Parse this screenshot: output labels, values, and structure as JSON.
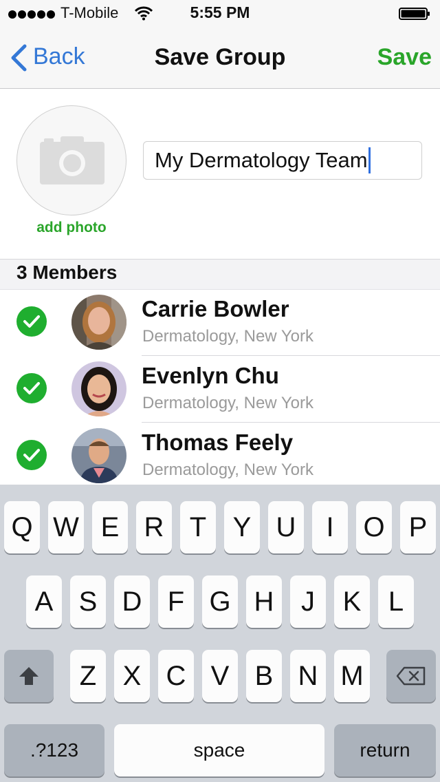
{
  "status_bar": {
    "carrier": "T-Mobile",
    "time": "5:55 PM"
  },
  "nav": {
    "back_label": "Back",
    "title": "Save Group",
    "save_label": "Save"
  },
  "group": {
    "add_photo_label": "add photo",
    "name_value": "My Dermatology Team"
  },
  "members": {
    "header": "3 Members",
    "items": [
      {
        "name": "Carrie Bowler",
        "subtitle": "Dermatology, New York",
        "selected": true
      },
      {
        "name": "Evenlyn Chu",
        "subtitle": "Dermatology, New York",
        "selected": true
      },
      {
        "name": "Thomas Feely",
        "subtitle": "Dermatology, New York",
        "selected": true
      }
    ]
  },
  "keyboard": {
    "row1": [
      "Q",
      "W",
      "E",
      "R",
      "T",
      "Y",
      "U",
      "I",
      "O",
      "P"
    ],
    "row2": [
      "A",
      "S",
      "D",
      "F",
      "G",
      "H",
      "J",
      "K",
      "L"
    ],
    "row3": [
      "Z",
      "X",
      "C",
      "V",
      "B",
      "N",
      "M"
    ],
    "numbers_label": ".?123",
    "space_label": "space",
    "return_label": "return",
    "icons": {
      "shift": "shift-icon",
      "delete": "delete-icon"
    }
  },
  "colors": {
    "accent_green": "#2aa52a",
    "back_blue": "#3478d6",
    "caret_blue": "#2f6fe0",
    "check_green": "#1fae2f"
  }
}
